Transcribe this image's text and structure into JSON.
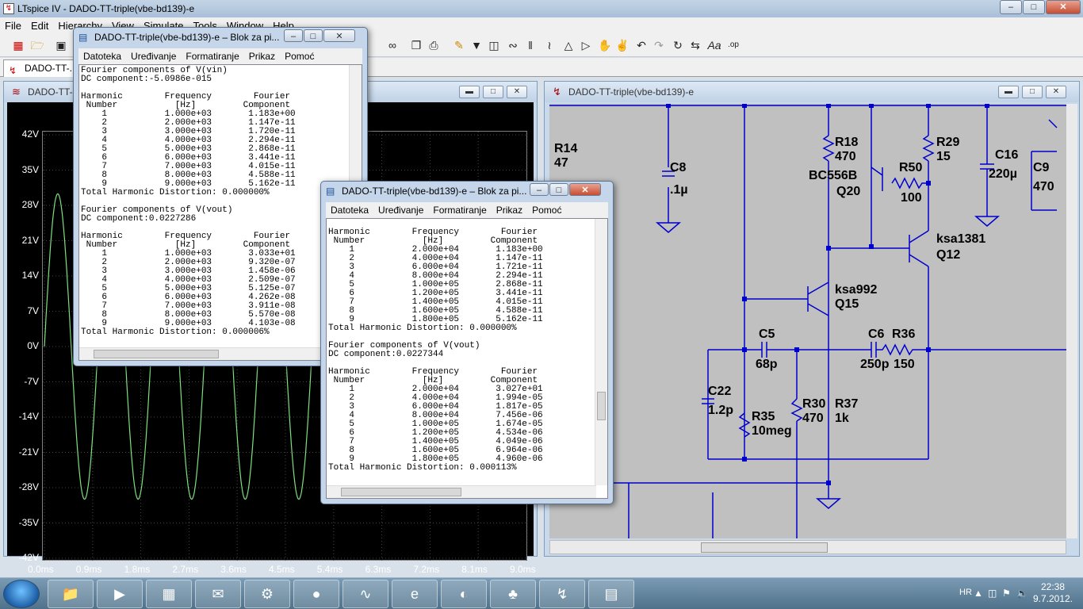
{
  "app": {
    "title": "LTspice IV - DADO-TT-triple(vbe-bd139)-e",
    "menu": [
      "File",
      "Edit",
      "Hierarchy",
      "View",
      "Simulate",
      "Tools",
      "Window",
      "Help"
    ],
    "tab_label": "DADO-TT-...",
    "window_buttons": {
      "min": "–",
      "max": "□",
      "close": "✕"
    }
  },
  "waveform": {
    "title": "DADO-TT-...",
    "y_ticks": [
      "42V",
      "35V",
      "28V",
      "21V",
      "14V",
      "7V",
      "0V",
      "-7V",
      "-14V",
      "-21V",
      "-28V",
      "-35V",
      "-42V"
    ],
    "x_ticks": [
      "0.0ms",
      "0.9ms",
      "1.8ms",
      "2.7ms",
      "3.6ms",
      "4.5ms",
      "5.4ms",
      "6.3ms",
      "7.2ms",
      "8.1ms",
      "9.0ms"
    ],
    "trace_color": "#7ee07e"
  },
  "schematic": {
    "title": "DADO-TT-triple(vbe-bd139)-e",
    "wire_color": "#0000cc",
    "labels": {
      "r14": "R14",
      "r14v": "47",
      "c8": "C8",
      "c8v": ".1µ",
      "r18": "R18",
      "r18v": "470",
      "bc556b": "BC556B",
      "q20": "Q20",
      "r50": "R50",
      "r50v": "100",
      "r29": "R29",
      "r29v": "15",
      "c16": "C16",
      "c16v": "220µ",
      "c9": "C9",
      "c9v": "470",
      "ksa1381": "ksa1381",
      "q12": "Q12",
      "ksa992": "ksa992",
      "q15": "Q15",
      "c5": "C5",
      "c5v": "68p",
      "c6": "C6",
      "c6v": "250p",
      "r36": "R36",
      "r36v": "150",
      "c22": "C22",
      "c22v": "1.2p",
      "r35": "R35",
      "r35v": "10meg",
      "r30": "R30",
      "r30v": "470",
      "r37": "R37",
      "r37v": "1k"
    }
  },
  "notepad1": {
    "title": "DADO-TT-triple(vbe-bd139)-e – Blok za pi...",
    "menu": [
      "Datoteka",
      "Uređivanje",
      "Formatiranje",
      "Prikaz",
      "Pomoć"
    ],
    "text": "Fourier components of V(vin)\nDC component:-5.0986e-015\n\nHarmonic        Frequency        Fourier\n Number           [Hz]         Component\n    1           1.000e+03       1.183e+00\n    2           2.000e+03       1.147e-11\n    3           3.000e+03       1.720e-11\n    4           4.000e+03       2.294e-11\n    5           5.000e+03       2.868e-11\n    6           6.000e+03       3.441e-11\n    7           7.000e+03       4.015e-11\n    8           8.000e+03       4.588e-11\n    9           9.000e+03       5.162e-11\nTotal Harmonic Distortion: 0.000000%\n\nFourier components of V(vout)\nDC component:0.0227286\n\nHarmonic        Frequency        Fourier\n Number           [Hz]         Component\n    1           1.000e+03       3.033e+01\n    2           2.000e+03       9.320e-07\n    3           3.000e+03       1.458e-06\n    4           4.000e+03       2.509e-07\n    5           5.000e+03       5.125e-07\n    6           6.000e+03       4.262e-08\n    7           7.000e+03       3.911e-08\n    8           8.000e+03       5.570e-08\n    9           9.000e+03       4.103e-08\nTotal Harmonic Distortion: 0.000006%"
  },
  "notepad2": {
    "title": "DADO-TT-triple(vbe-bd139)-e – Blok za pi...",
    "menu": [
      "Datoteka",
      "Uređivanje",
      "Formatiranje",
      "Prikaz",
      "Pomoć"
    ],
    "text": "Harmonic        Frequency        Fourier\n Number           [Hz]         Component\n    1           2.000e+04       1.183e+00\n    2           4.000e+04       1.147e-11\n    3           6.000e+04       1.721e-11\n    4           8.000e+04       2.294e-11\n    5           1.000e+05       2.868e-11\n    6           1.200e+05       3.441e-11\n    7           1.400e+05       4.015e-11\n    8           1.600e+05       4.588e-11\n    9           1.800e+05       5.162e-11\nTotal Harmonic Distortion: 0.000000%\n\nFourier components of V(vout)\nDC component:0.0227344\n\nHarmonic        Frequency        Fourier\n Number           [Hz]         Component\n    1           2.000e+04       3.027e+01\n    2           4.000e+04       1.994e-05\n    3           6.000e+04       1.817e-05\n    4           8.000e+04       7.456e-06\n    5           1.000e+05       1.674e-05\n    6           1.200e+05       4.534e-06\n    7           1.400e+05       4.049e-06\n    8           1.600e+05       6.964e-06\n    9           1.800e+05       4.960e-06\nTotal Harmonic Distortion: 0.000113%"
  },
  "taskbar": {
    "lang": "HR",
    "time": "22:38",
    "date": "9.7.2012.",
    "items": [
      "explorer-icon",
      "media-player-icon",
      "photo-gallery-icon",
      "mail-icon",
      "tool-icon",
      "ccleaner-icon",
      "oscilloscope-icon",
      "internet-explorer-icon",
      "firefox-icon",
      "acrobat-icon",
      "ltspice-icon",
      "notepad-icon"
    ]
  }
}
